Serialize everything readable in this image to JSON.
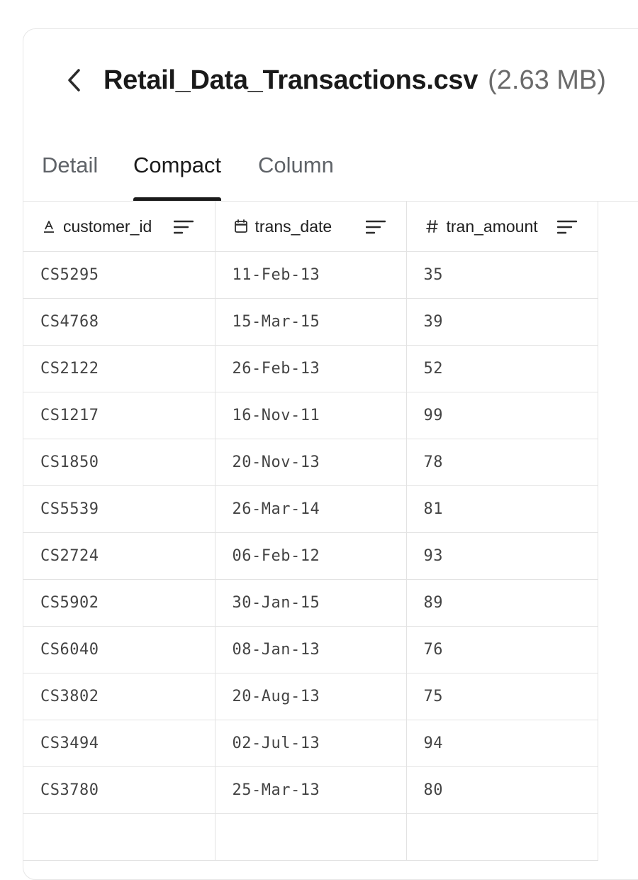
{
  "header": {
    "title": "Retail_Data_Transactions.csv",
    "size_label": "(2.63 MB)"
  },
  "tabs": [
    {
      "label": "Detail",
      "active": false
    },
    {
      "label": "Compact",
      "active": true
    },
    {
      "label": "Column",
      "active": false
    }
  ],
  "columns": [
    {
      "name": "customer_id",
      "type_icon": "text-type-icon"
    },
    {
      "name": "trans_date",
      "type_icon": "calendar-icon"
    },
    {
      "name": "tran_amount",
      "type_icon": "hash-icon"
    }
  ],
  "rows": [
    [
      "CS5295",
      "11-Feb-13",
      "35"
    ],
    [
      "CS4768",
      "15-Mar-15",
      "39"
    ],
    [
      "CS2122",
      "26-Feb-13",
      "52"
    ],
    [
      "CS1217",
      "16-Nov-11",
      "99"
    ],
    [
      "CS1850",
      "20-Nov-13",
      "78"
    ],
    [
      "CS5539",
      "26-Mar-14",
      "81"
    ],
    [
      "CS2724",
      "06-Feb-12",
      "93"
    ],
    [
      "CS5902",
      "30-Jan-15",
      "89"
    ],
    [
      "CS6040",
      "08-Jan-13",
      "76"
    ],
    [
      "CS3802",
      "20-Aug-13",
      "75"
    ],
    [
      "CS3494",
      "02-Jul-13",
      "94"
    ],
    [
      "CS3780",
      "25-Mar-13",
      "80"
    ],
    [
      "",
      "",
      ""
    ]
  ],
  "colors": {
    "accent": "#1a1a1a",
    "muted_text": "#5f6368",
    "border": "#e3e3e3"
  }
}
